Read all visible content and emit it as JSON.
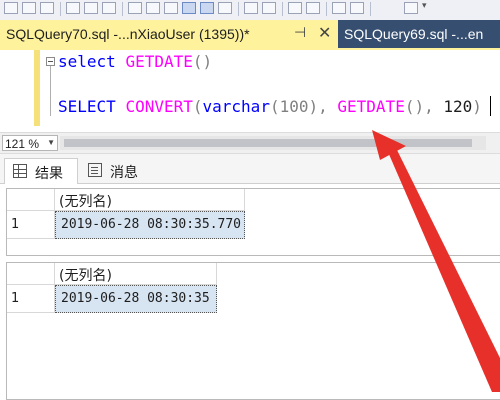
{
  "document_tabs": [
    {
      "title": "SQLQuery70.sql -...nXiaoUser (1395))*",
      "active": true
    },
    {
      "title": "SQLQuery69.sql -...en",
      "active": false
    }
  ],
  "tab_icons": {
    "pin": "pin-icon",
    "close": "close-icon"
  },
  "editor": {
    "line1": {
      "keyword": "select",
      "function": "GETDATE",
      "rest": "()"
    },
    "line2": {
      "keyword": "SELECT",
      "function": "CONVERT",
      "open": "(",
      "type": "varchar",
      "type_arg": "(100)",
      "comma1": ", ",
      "function2": "GETDATE",
      "parens2": "()",
      "comma2": ", ",
      "style": "120",
      "close": ")"
    }
  },
  "zoom": {
    "value": "121 %"
  },
  "result_tabs": [
    {
      "label": "结果",
      "icon": "grid-icon"
    },
    {
      "label": "消息",
      "icon": "messages-icon"
    }
  ],
  "result_sets": [
    {
      "column_header": "(无列名)",
      "rows": [
        {
          "num": "1",
          "value": "2019-06-28 08:30:35.770"
        }
      ]
    },
    {
      "column_header": "(无列名)",
      "rows": [
        {
          "num": "1",
          "value": "2019-06-28 08:30:35"
        }
      ]
    }
  ],
  "colors": {
    "active_tab": "#fff29d",
    "tab_strip": "#293955",
    "keyword": "#0000ff",
    "function": "#ff00ff",
    "selected_cell": "#d7e4f2",
    "annotation_arrow": "#e8302a"
  }
}
